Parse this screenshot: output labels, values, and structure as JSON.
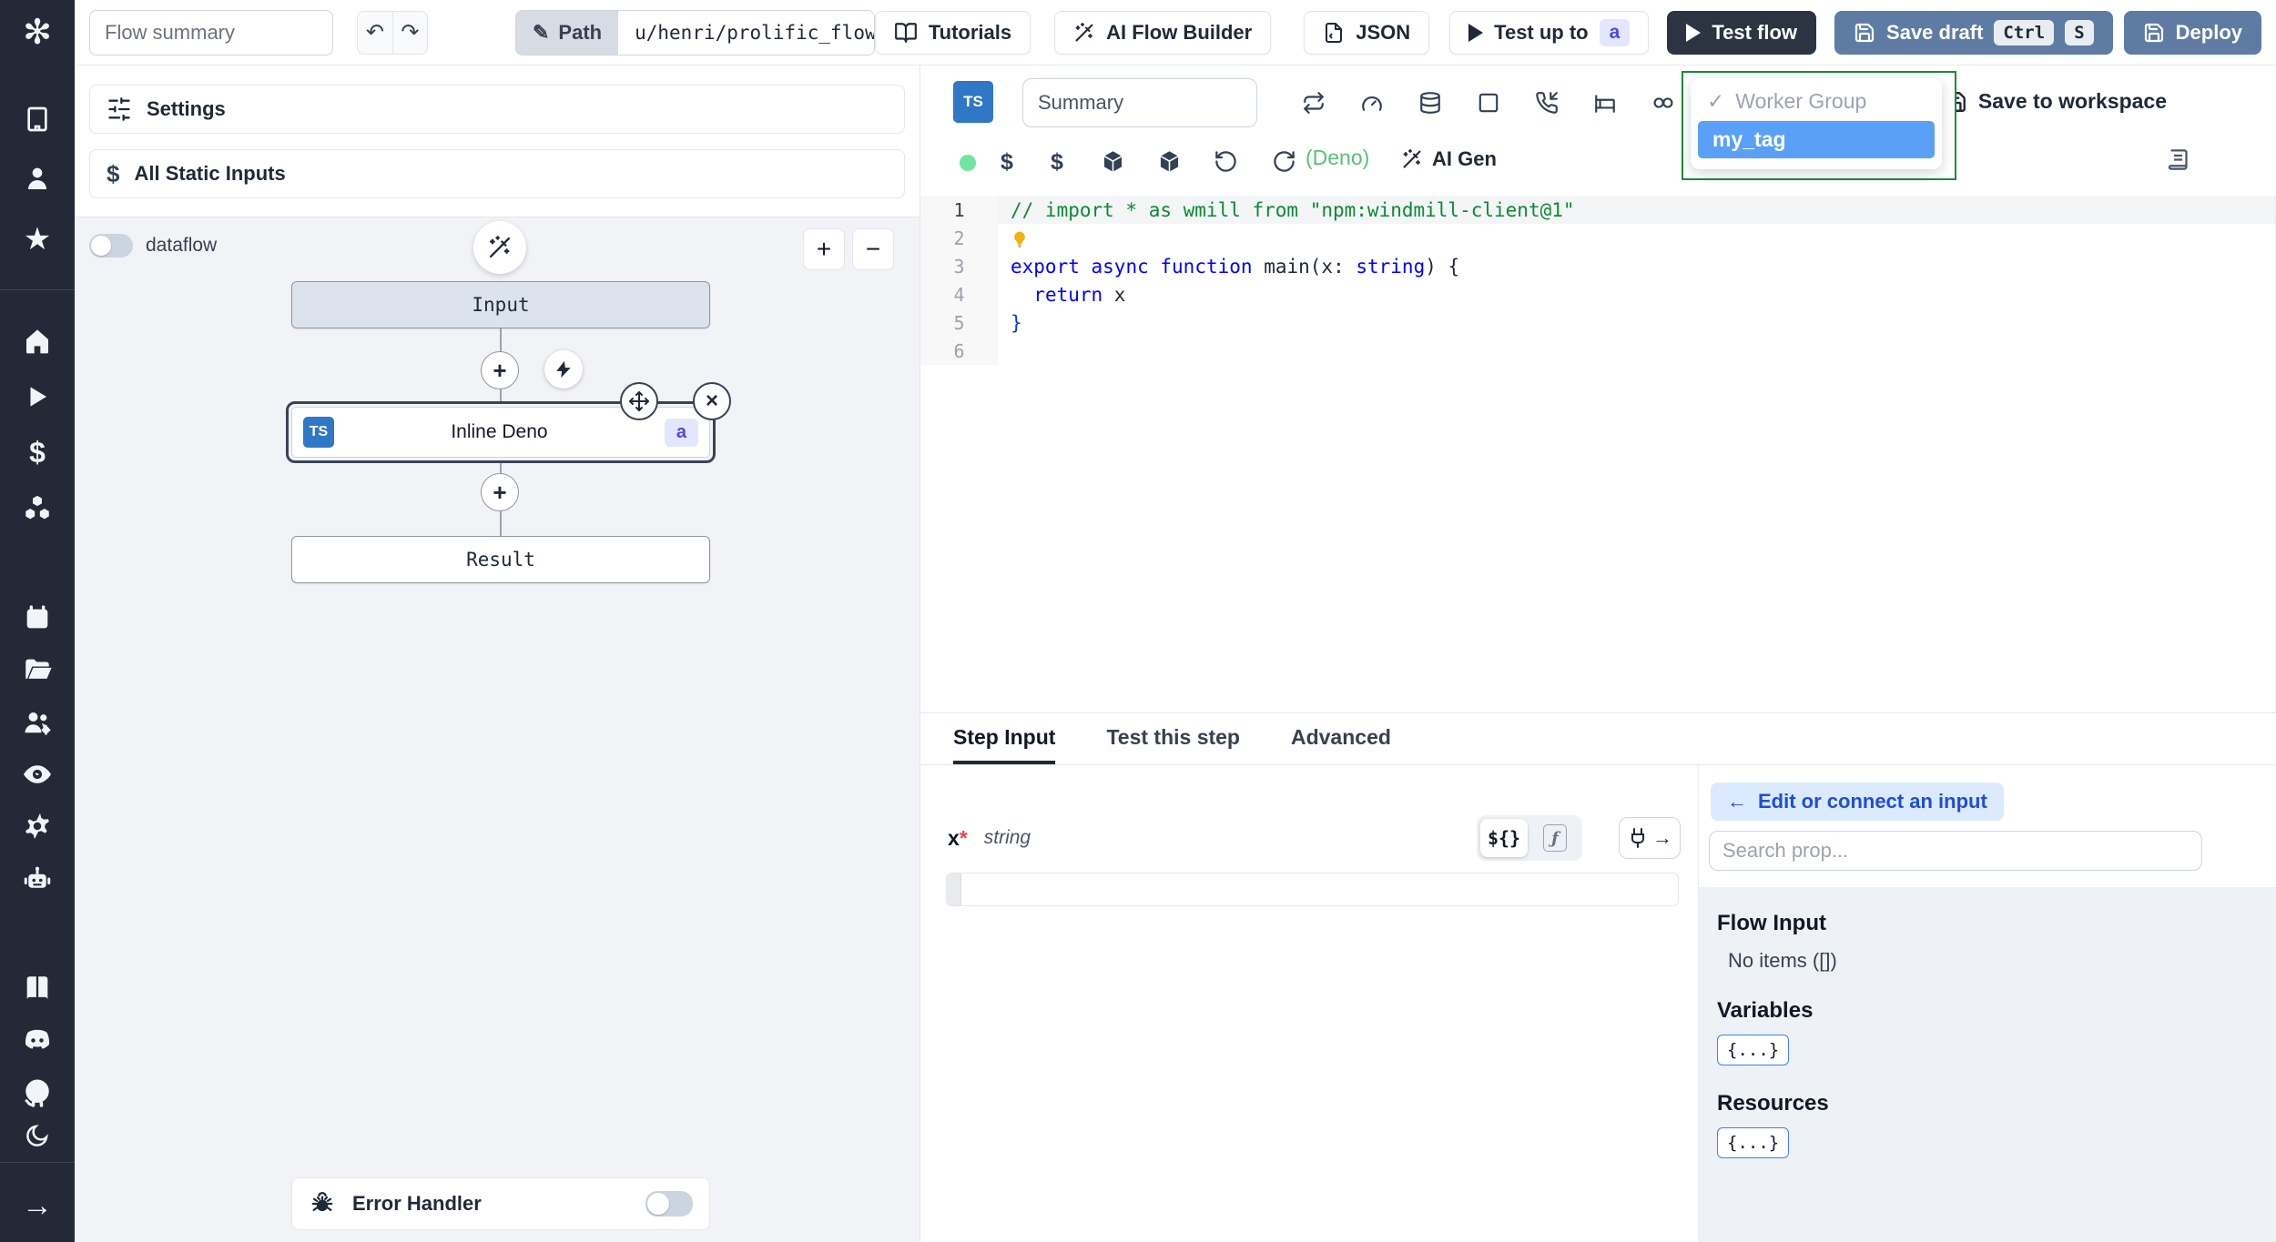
{
  "topbar": {
    "flow_summary_placeholder": "Flow summary",
    "undo": "↶",
    "redo": "↷",
    "path_label": "Path",
    "path_value": "u/henri/prolific_flow",
    "tutorials": "Tutorials",
    "ai_flow_builder": "AI Flow Builder",
    "json": "JSON",
    "test_up_to": "Test up to",
    "test_up_to_badge": "a",
    "test_flow": "Test flow",
    "save_draft": "Save draft",
    "kbd_ctrl": "Ctrl",
    "kbd_s": "S",
    "deploy": "Deploy"
  },
  "left_panel": {
    "settings": "Settings",
    "all_static_inputs": "All Static Inputs",
    "dataflow_label": "dataflow",
    "zoom_in": "+",
    "zoom_out": "−",
    "nodes": {
      "input": "Input",
      "step_lang_badge": "TS",
      "step_label": "Inline Deno",
      "step_id_badge": "a",
      "result": "Result"
    },
    "error_handler": "Error Handler"
  },
  "editor": {
    "lang_badge": "TS",
    "summary_placeholder": "Summary",
    "deno_hint": "(Deno)",
    "ai_gen": "AI Gen",
    "save_to_workspace": "Save to workspace",
    "worker_group_dropdown": {
      "check": "✓",
      "header": "Worker Group",
      "selected": "my_tag"
    },
    "code": {
      "lines": [
        {
          "n": "1",
          "hl": true,
          "tokens": [
            [
              "cmt",
              "// import * as wmill from \"npm:windmill-client@1\""
            ]
          ]
        },
        {
          "n": "2",
          "bulb": true,
          "tokens": []
        },
        {
          "n": "3",
          "tokens": [
            [
              "kw",
              "export"
            ],
            [
              "pl",
              " "
            ],
            [
              "kw",
              "async"
            ],
            [
              "pl",
              " "
            ],
            [
              "kw",
              "function"
            ],
            [
              "pl",
              " "
            ],
            [
              "id",
              "main"
            ],
            [
              "pl",
              "(x: "
            ],
            [
              "ty",
              "string"
            ],
            [
              "pl",
              ") {"
            ]
          ]
        },
        {
          "n": "4",
          "tokens": [
            [
              "pl",
              "  "
            ],
            [
              "kw",
              "return"
            ],
            [
              "pl",
              " x"
            ]
          ]
        },
        {
          "n": "5",
          "tokens": [
            [
              "br",
              "}"
            ]
          ]
        },
        {
          "n": "6",
          "tokens": []
        }
      ]
    }
  },
  "bottom": {
    "tabs": [
      {
        "label": "Step Input",
        "active": true
      },
      {
        "label": "Test this step",
        "active": false
      },
      {
        "label": "Advanced",
        "active": false
      }
    ],
    "field": {
      "name": "x",
      "required_mark": "*",
      "type": "string",
      "template_toggle": "${}",
      "fn_toggle": "ƒ"
    },
    "prop_picker": {
      "back_arrow": "←",
      "edit_or_connect": "Edit or connect an input",
      "search_placeholder": "Search prop...",
      "flow_input_title": "Flow Input",
      "flow_input_empty": "No items ([])",
      "variables_title": "Variables",
      "variables_chip": "{...}",
      "resources_title": "Resources",
      "resources_chip": "{...}"
    }
  },
  "colors": {
    "sidebar_bg": "#232936",
    "accent_blue": "#3077c6",
    "steel_button": "#5e7ca3",
    "dark_button": "#2b3440",
    "dropdown_border_green": "#1a8a3f",
    "dropdown_selected_blue": "#5aa0f6",
    "badge_indigo_bg": "#e3e6fd",
    "badge_indigo_text": "#4f46e5",
    "lang_ready_green": "#72e3a0",
    "deno_green": "#5bbf7a",
    "comment_green": "#0b8a34",
    "keyword_blue": "#0000ff"
  },
  "icons": [
    "windmill-logo",
    "building-icon",
    "user-icon",
    "star-icon",
    "home-icon",
    "play-icon",
    "dollar-icon",
    "cubes-icon",
    "calendar-icon",
    "folder-icon",
    "users-gear-icon",
    "eye-icon",
    "gear-icon",
    "robot-icon",
    "book-icon",
    "discord-icon",
    "github-icon",
    "moon-icon",
    "arrow-right-icon",
    "pencil-icon",
    "book-open-icon",
    "wand-icon",
    "file-json-icon",
    "save-icon",
    "sliders-icon",
    "lightning-icon",
    "move-icon",
    "close-icon",
    "plus-icon",
    "bug-icon",
    "retry-icon",
    "early-stop-gauge-icon",
    "cache-database-icon",
    "mock-square-icon",
    "suspend-phone-icon",
    "sleep-bed-icon",
    "concurrency-icon",
    "cube-icon",
    "reset-icon",
    "reload-icon",
    "lightbulb-icon",
    "plug-icon",
    "search-icon"
  ]
}
